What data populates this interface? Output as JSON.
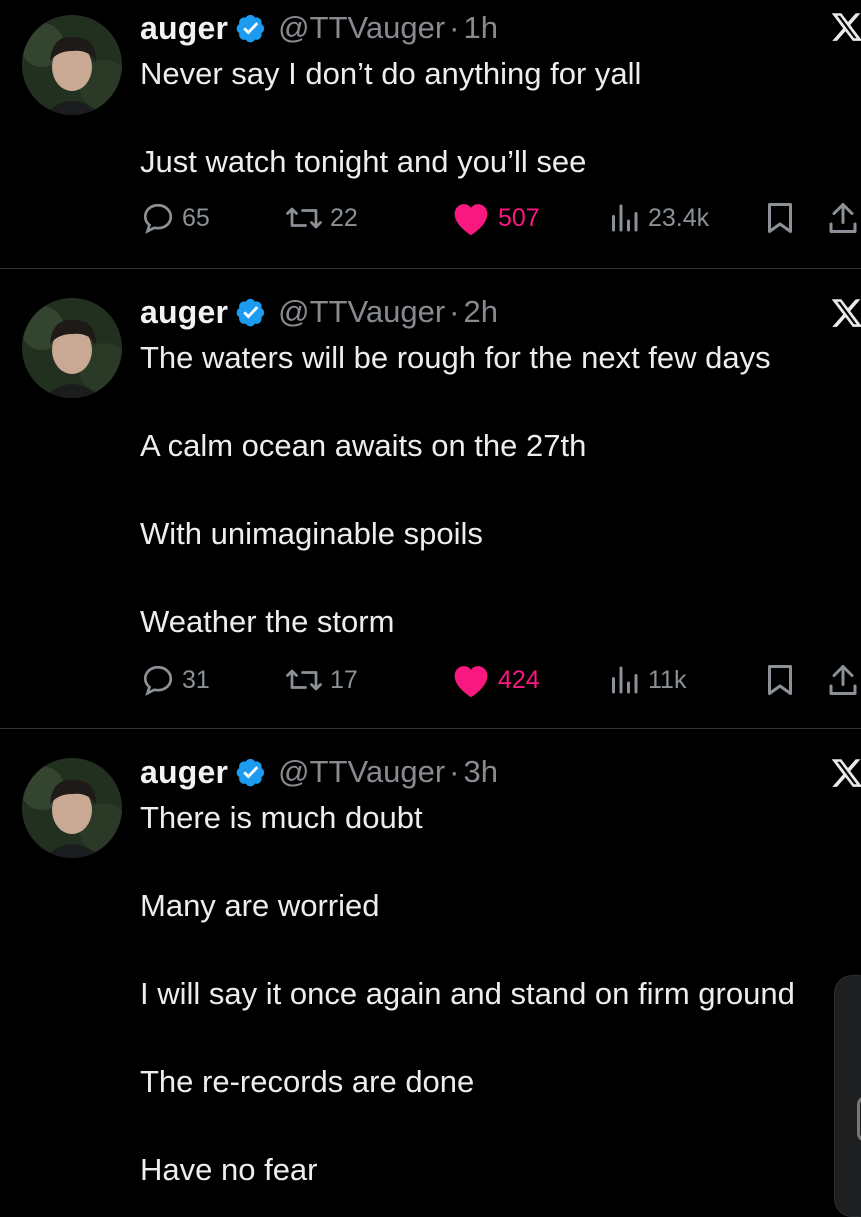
{
  "tweets": [
    {
      "name": "auger",
      "handle": "@TTVauger",
      "separator": "·",
      "time": "1h",
      "lines": [
        "Never say I don’t do anything for yall",
        "Just watch tonight and you’ll see"
      ],
      "replies": "65",
      "retweets": "22",
      "likes": "507",
      "views": "23.4k"
    },
    {
      "name": "auger",
      "handle": "@TTVauger",
      "separator": "·",
      "time": "2h",
      "lines": [
        "The waters will be rough for the next few days",
        "A calm ocean awaits on the 27th",
        "With unimaginable spoils",
        "Weather the storm"
      ],
      "replies": "31",
      "retweets": "17",
      "likes": "424",
      "views": "11k"
    },
    {
      "name": "auger",
      "handle": "@TTVauger",
      "separator": "·",
      "time": "3h",
      "lines": [
        "There is much doubt",
        "Many are worried",
        "I will say it once again and stand on firm ground",
        "The re-records are done",
        "Have no fear"
      ]
    }
  ],
  "icons": {
    "verified": "verified-badge-icon",
    "x_logo": "x-logo-icon",
    "reply": "reply-icon",
    "retweet": "retweet-icon",
    "like": "heart-icon",
    "views": "views-icon",
    "bookmark": "bookmark-icon",
    "share": "share-icon"
  },
  "colors": {
    "background": "#000000",
    "like_active": "#f91880",
    "verified": "#1d9bf0",
    "muted": "#878b90"
  }
}
